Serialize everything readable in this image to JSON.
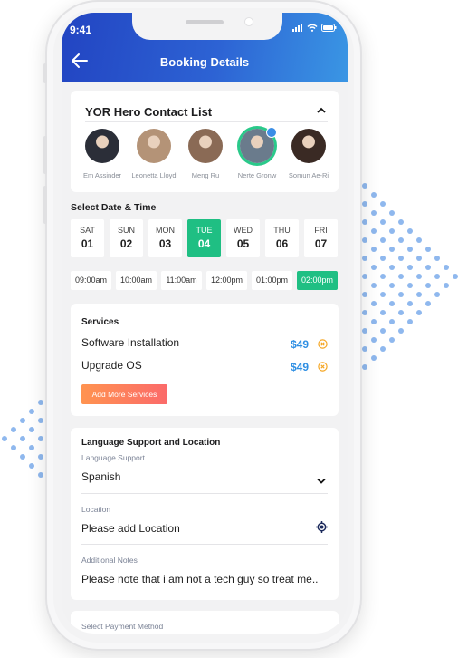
{
  "status_bar": {
    "time": "9:41",
    "icons": [
      "signal-icon",
      "wifi-icon",
      "battery-icon"
    ]
  },
  "header": {
    "title": "Booking Details",
    "back_icon": "arrow-left-icon"
  },
  "contacts": {
    "title": "YOR Hero Contact List",
    "toggle_icon": "chevron-up-icon",
    "people": [
      {
        "name": "Em Assinder",
        "selected": false,
        "color": "#2b2e38"
      },
      {
        "name": "Leonetta Lloyd",
        "selected": false,
        "color": "#b49377"
      },
      {
        "name": "Meng Ru",
        "selected": false,
        "color": "#8a6a55"
      },
      {
        "name": "Nerte Gronw",
        "selected": true,
        "color": "#6a7b8c"
      },
      {
        "name": "Somun Ae-Ri",
        "selected": false,
        "color": "#3a2a24"
      }
    ]
  },
  "schedule": {
    "label": "Select Date & Time",
    "days": [
      {
        "name": "SAT",
        "date": "01",
        "active": false
      },
      {
        "name": "SUN",
        "date": "02",
        "active": false
      },
      {
        "name": "MON",
        "date": "03",
        "active": false
      },
      {
        "name": "TUE",
        "date": "04",
        "active": true
      },
      {
        "name": "WED",
        "date": "05",
        "active": false
      },
      {
        "name": "THU",
        "date": "06",
        "active": false
      },
      {
        "name": "FRI",
        "date": "07",
        "active": false
      }
    ],
    "times": [
      {
        "label": "09:00am",
        "active": false
      },
      {
        "label": "10:00am",
        "active": false
      },
      {
        "label": "11:00am",
        "active": false
      },
      {
        "label": "12:00pm",
        "active": false
      },
      {
        "label": "01:00pm",
        "active": false
      },
      {
        "label": "02:00pm",
        "active": true
      }
    ]
  },
  "services": {
    "title": "Services",
    "items": [
      {
        "name": "Software Installation",
        "price": "$49"
      },
      {
        "name": "Upgrade OS",
        "price": "$49"
      }
    ],
    "add_label": "Add More Services"
  },
  "language": {
    "title": "Language Support and Location",
    "language_label": "Language Support",
    "language_value": "Spanish",
    "location_label": "Location",
    "location_placeholder": "Please add Location",
    "notes_label": "Additional Notes",
    "notes_value": "Please note that i am not a tech guy so treat me.."
  },
  "payment": {
    "label": "Select Payment Method"
  },
  "colors": {
    "accent_green": "#1fbf83",
    "price_blue": "#2f8fe3",
    "remove_orange": "#f5a623",
    "header_start": "#2244c2",
    "header_end": "#3a96e4"
  }
}
